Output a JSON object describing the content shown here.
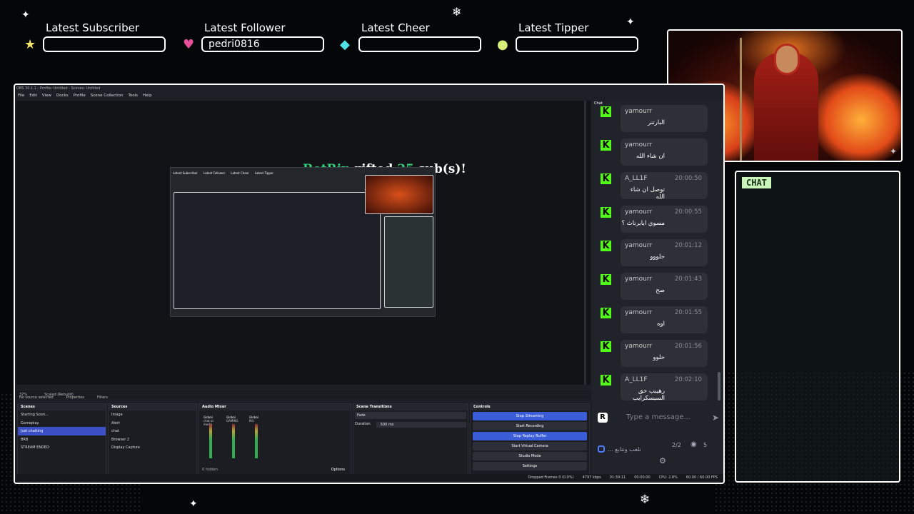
{
  "alerts": [
    {
      "label": "Latest Subscriber",
      "value": "",
      "icon": "star-icon"
    },
    {
      "label": "Latest Follower",
      "value": "pedri0816",
      "icon": "heart-icon"
    },
    {
      "label": "Latest Cheer",
      "value": "",
      "icon": "diamond-icon"
    },
    {
      "label": "Latest Tipper",
      "value": "",
      "icon": "coin-icon"
    }
  ],
  "chat_overlay": {
    "tag": "CHAT"
  },
  "obs": {
    "window_title": "OBS 30.1.1 - Profile: Untitled - Scenes: Untitled",
    "menu": [
      "File",
      "Edit",
      "View",
      "Docks",
      "Profile",
      "Scene Collection",
      "Tools",
      "Help"
    ],
    "gift": {
      "user": "BotRix",
      "word1": "gifted",
      "count": "25",
      "word2": "sub(s)!"
    },
    "preview_status": {
      "zoom": "37%",
      "mode": "Scaled (Rebuild)"
    },
    "source_strip": {
      "selected": "No source selected",
      "properties": "Properties",
      "filters": "Filters"
    },
    "scenes": {
      "title": "Scenes",
      "items": [
        "Starting Soon...",
        "Gameplay",
        "Just chatting",
        "BRB",
        "STREAM ENDED"
      ]
    },
    "sources": {
      "title": "Sources",
      "items": [
        "Image",
        "Alert",
        "chat",
        "Browser 2",
        "Display Capture"
      ]
    },
    "mixer": {
      "title": "Audio Mixer",
      "channels": [
        {
          "scope": "Global",
          "name": "chat or media",
          "db": "-20.0 dB"
        },
        {
          "scope": "Global",
          "name": "GAMING",
          "db": "-20.0 dB"
        },
        {
          "scope": "Global",
          "name": "Mic",
          "db": "0.0 dB"
        }
      ],
      "hidden": "0 hidden",
      "options": "Options"
    },
    "transitions": {
      "title": "Scene Transitions",
      "type": "Fade",
      "duration_label": "Duration",
      "duration": "500 ms"
    },
    "controls": {
      "title": "Controls",
      "buttons": [
        "Stop Streaming",
        "Start Recording",
        "Stop Replay Buffer",
        "Start Virtual Camera",
        "Studio Mode",
        "Settings"
      ]
    },
    "status": [
      "Dropped Frames 0 (0.0%)",
      "4797 kbps",
      "01:39:11",
      "00:00:00",
      "CPU: 2.8%",
      "60.00 / 60.00 FPS"
    ]
  },
  "chat": {
    "header": "Chat",
    "messages": [
      {
        "user": "yamourr",
        "time": "",
        "text": "البارتنر"
      },
      {
        "user": "yamourr",
        "time": "",
        "text": "ان شاء الله"
      },
      {
        "user": "A_LL1F",
        "time": "20:00:50",
        "text": "توصل ان شاء الله"
      },
      {
        "user": "yamourr",
        "time": "20:00:55",
        "text": "مسوي ايابرناث ؟"
      },
      {
        "user": "yamourr",
        "time": "20:01:12",
        "text": "حلووو"
      },
      {
        "user": "yamourr",
        "time": "20:01:43",
        "text": "صح"
      },
      {
        "user": "yamourr",
        "time": "20:01:55",
        "text": "اوه"
      },
      {
        "user": "yamourr",
        "time": "20:01:56",
        "text": "حلوو"
      },
      {
        "user": "A_LL1F",
        "time": "20:02:10",
        "text": "رهيبب حق السبسكرايب"
      }
    ],
    "input_placeholder": "Type a message...",
    "footer_title": "... نلعب ونتابع",
    "counts": "2/2",
    "viewers": "5"
  },
  "colors": {
    "kick_green": "#53fc18",
    "obs_blue": "#3b5dd8",
    "gift_green": "#33d178"
  }
}
